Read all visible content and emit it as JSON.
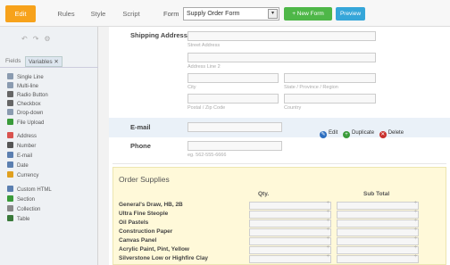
{
  "toolbar": {
    "tabs": [
      "Edit",
      "Rules",
      "Style",
      "Script"
    ],
    "form_label": "Form",
    "form_selected": "Supply Order Form",
    "new_form": "+ New Form",
    "preview": "Preview"
  },
  "sidebar": {
    "tabs": [
      "Fields",
      "Variables ✕"
    ],
    "items": [
      {
        "label": "Single Line",
        "color": "#8a9bb0"
      },
      {
        "label": "Multi-line",
        "color": "#8a9bb0"
      },
      {
        "label": "Radio Button",
        "color": "#666666"
      },
      {
        "label": "Checkbox",
        "color": "#666666"
      },
      {
        "label": "Drop-down",
        "color": "#8a9bb0"
      },
      {
        "label": "File Upload",
        "color": "#3a9b3a"
      },
      {
        "label": "Address",
        "color": "#d9534f"
      },
      {
        "label": "Number",
        "color": "#555555"
      },
      {
        "label": "E-mail",
        "color": "#5b7fb0"
      },
      {
        "label": "Date",
        "color": "#5b7fb0"
      },
      {
        "label": "Currency",
        "color": "#e0a020"
      },
      {
        "label": "Custom HTML",
        "color": "#5b7fb0"
      },
      {
        "label": "Section",
        "color": "#3a9b3a"
      },
      {
        "label": "Collection",
        "color": "#888888"
      },
      {
        "label": "Table",
        "color": "#3a7a3a"
      }
    ]
  },
  "form": {
    "shipping_label": "Shipping Address",
    "street": "Street Address",
    "line2": "Address Line 2",
    "city": "City",
    "state": "State / Province / Region",
    "postal": "Postal / Zip Code",
    "country": "Country",
    "email_label": "E-mail",
    "phone_label": "Phone",
    "phone_hint": "eg. 562-555-6666",
    "actions": {
      "edit": "Edit",
      "duplicate": "Duplicate",
      "delete": "Delete"
    },
    "order": {
      "title": "Order Supplies",
      "qty": "Qty.",
      "subtotal": "Sub Total",
      "rows": [
        "General's Draw, HB, 2B",
        "Ultra Fine Steople",
        "Oil Pastels",
        "Construction Paper",
        "Canvas Panel",
        "Acrylic Paint, Pint, Yellow",
        "Silverstone Low or Highfire Clay"
      ]
    }
  }
}
